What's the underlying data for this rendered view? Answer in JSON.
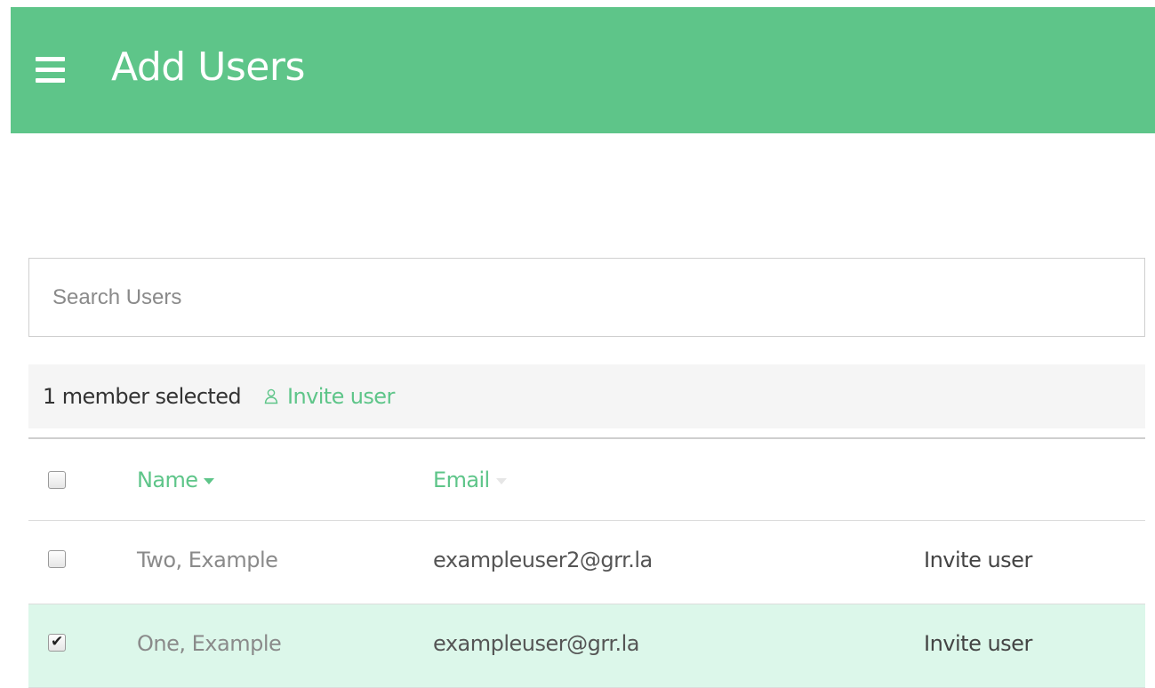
{
  "header": {
    "title": "Add Users",
    "background_color": "#5ec589"
  },
  "search": {
    "placeholder": "Search Users",
    "value": ""
  },
  "selection_bar": {
    "selected_text": "1 member selected",
    "invite_label": "Invite user",
    "invite_icon": "user-icon"
  },
  "table": {
    "columns": {
      "name": "Name",
      "email": "Email"
    },
    "sort": {
      "column": "Name",
      "direction": "descending-caret"
    },
    "rows": [
      {
        "checked": false,
        "name": "Two, Example",
        "email": "exampleuser2@grr.la",
        "action": "Invite user"
      },
      {
        "checked": true,
        "name": "One, Example",
        "email": "exampleuser@grr.la",
        "action": "Invite user"
      }
    ]
  },
  "colors": {
    "accent": "#5ec589",
    "selected_row": "#dcf7ea"
  }
}
